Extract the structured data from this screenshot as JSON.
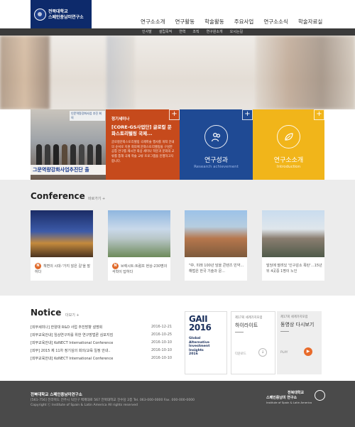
{
  "header": {
    "logo_line1": "전북대학교",
    "logo_line2": "스페인중남미연구소",
    "logo_line3": "Institute of Spain & Latin America",
    "main_nav": [
      "연구소소개",
      "연구활동",
      "학술활동",
      "주요사업",
      "연구소소식",
      "학술자료실"
    ],
    "sub_nav": [
      "인사말",
      "설립목적",
      "연혁",
      "조직",
      "연구원소개",
      "오시는길"
    ]
  },
  "panels": {
    "photo_banner": "그문역량강화사업추진단 출",
    "photo_sign": "인문역량강화사업 추진 회의",
    "news": {
      "category": "정기세미나",
      "title": "[CORE-GS사업단] 글로컬 문화스토리텔링 국제...",
      "body": "글로컬문화스토리텔링 국제학술 행사를 개최 안내의 순서로 지원 회의에 문화스토리텔링을 구성한 공통 연구를 제시한 화상 세미나 학문과 문화의 교류를 통해 국제 학술 교류 프로그램을 진행하고자 합니다."
    },
    "results": {
      "title": "연구성과",
      "subtitle": "Research achievement"
    },
    "intro": {
      "title": "연구소소개",
      "subtitle": "Introduction"
    },
    "plus": "+"
  },
  "conference": {
    "title": "Conference",
    "more": "바로가기 +",
    "cards": [
      {
        "badge": "N",
        "caption": "책변의 시대-'가지 않은 길'을 말하다"
      },
      {
        "badge": "N",
        "caption": "브렉시트:트럼프 현상-230명의 석학이 답하다"
      },
      {
        "badge": "",
        "caption": "\"中, 미래 100년 담을 콘텐츠 빈약…해법은 한국 기술과 문..."
      },
      {
        "badge": "",
        "caption": "빌딩에 딸려있 '인구감소 폭탄'…15년뒤 4곳중 1명이 노인"
      }
    ]
  },
  "notice": {
    "title": "Notice",
    "more": "더보기 +",
    "items": [
      {
        "text": "[외부세미나] 한양대 R&D 사업 추진방향 설명회",
        "date": "2016-12-21"
      },
      {
        "text": "[외부교육안내] 임상연구자를 위한 연구방법론 심포지엄",
        "date": "2016-10-25"
      },
      {
        "text": "[외부교육안내] KoNECT International Conference",
        "date": "2016-10-10"
      },
      {
        "text": "[외부] 2015 제 11차 정기심의 회의/교육 일정 안내..",
        "date": "2016-10-10"
      },
      {
        "text": "[외부교육안내] KoNECT International Conference",
        "date": "2016-10-10"
      }
    ]
  },
  "promo": {
    "gaii_big1": "GAII",
    "gaii_big2": "2016",
    "gaii_small": [
      "Global",
      "Alternative",
      "Investment",
      "Insights",
      "2016"
    ],
    "card1": {
      "label": "제17회 세계가지포럼",
      "title": "하이라이트",
      "action": "다운로드",
      "icon": "download-icon"
    },
    "card2": {
      "label": "제17회 세계가지포럼",
      "title": "동영상 다시보기",
      "action": "PLAY",
      "icon": "play-icon"
    }
  },
  "footer": {
    "name": "전북대학교 스페인중남미연구소",
    "address": "[561-756] 전라북도 전주시 덕진구 백제대로 567 전북대학교 진수당 2층   Tel. 063-000-0000  Fax. 000-000-0000",
    "copyright": "Copyright ⓒ Institute of Spain & Latin America All rights reserved",
    "logo_line1": "전북대학교",
    "logo_line2": "스페인중남미 연구소",
    "logo_line3": "Institute of Spain & Latin America"
  },
  "colors": {
    "navy": "#0d2a6b",
    "news_orange": "#c64a1c",
    "results_blue": "#1f4a94",
    "intro_yellow": "#f1b51a",
    "footer_gray": "#4a4a4a",
    "badge_orange": "#e06a2a"
  }
}
